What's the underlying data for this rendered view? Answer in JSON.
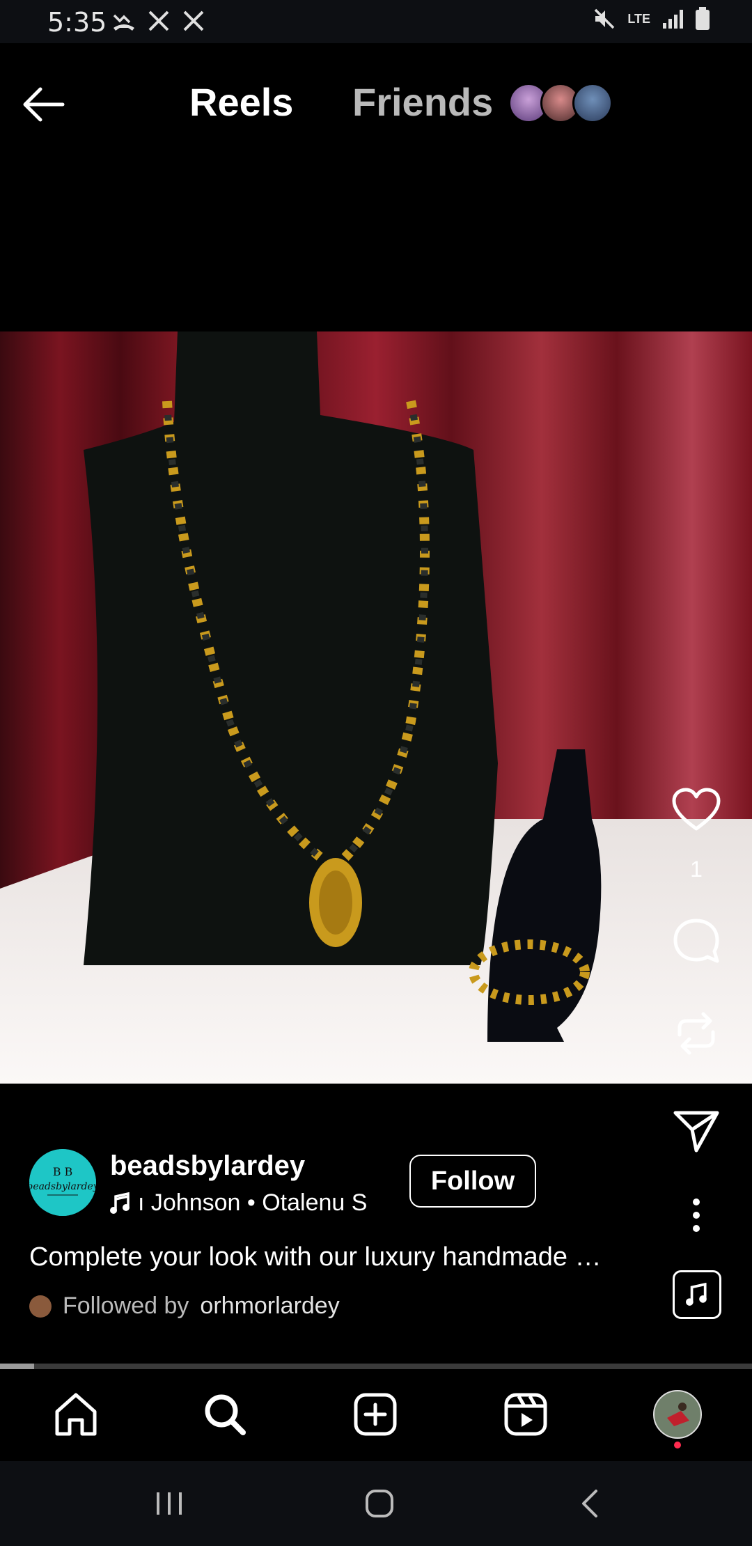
{
  "status_bar": {
    "time": "5:35",
    "left_icons": [
      "missed-call-icon",
      "x-app-icon",
      "x-app-icon"
    ],
    "right_icons": [
      "mute-icon",
      "lte-data-icon",
      "signal-icon",
      "battery-icon"
    ],
    "network_label": "LTE"
  },
  "header": {
    "tabs": [
      {
        "label": "Reels",
        "active": true
      },
      {
        "label": "Friends",
        "active": false
      }
    ]
  },
  "actions": {
    "like_count": "1"
  },
  "post": {
    "username": "beadsbylardey",
    "avatar_text": "beadsbylardey",
    "music_text": "ı Johnson • Otalenu    S",
    "follow_label": "Follow",
    "caption": "Complete your look with our luxury handmade …",
    "followed_by_prefix": "Followed by",
    "followed_by_user": "orhmorlardey"
  },
  "playback": {
    "progress": 0.045
  },
  "colors": {
    "background": "#000000",
    "statusbar": "#0d0f13",
    "avatar_bg": "#1ec6c6",
    "curtain": "#7a0f1a",
    "bust": "#0e1210",
    "gold": "#c99a1d",
    "notification_dot": "#ff2b4f"
  }
}
